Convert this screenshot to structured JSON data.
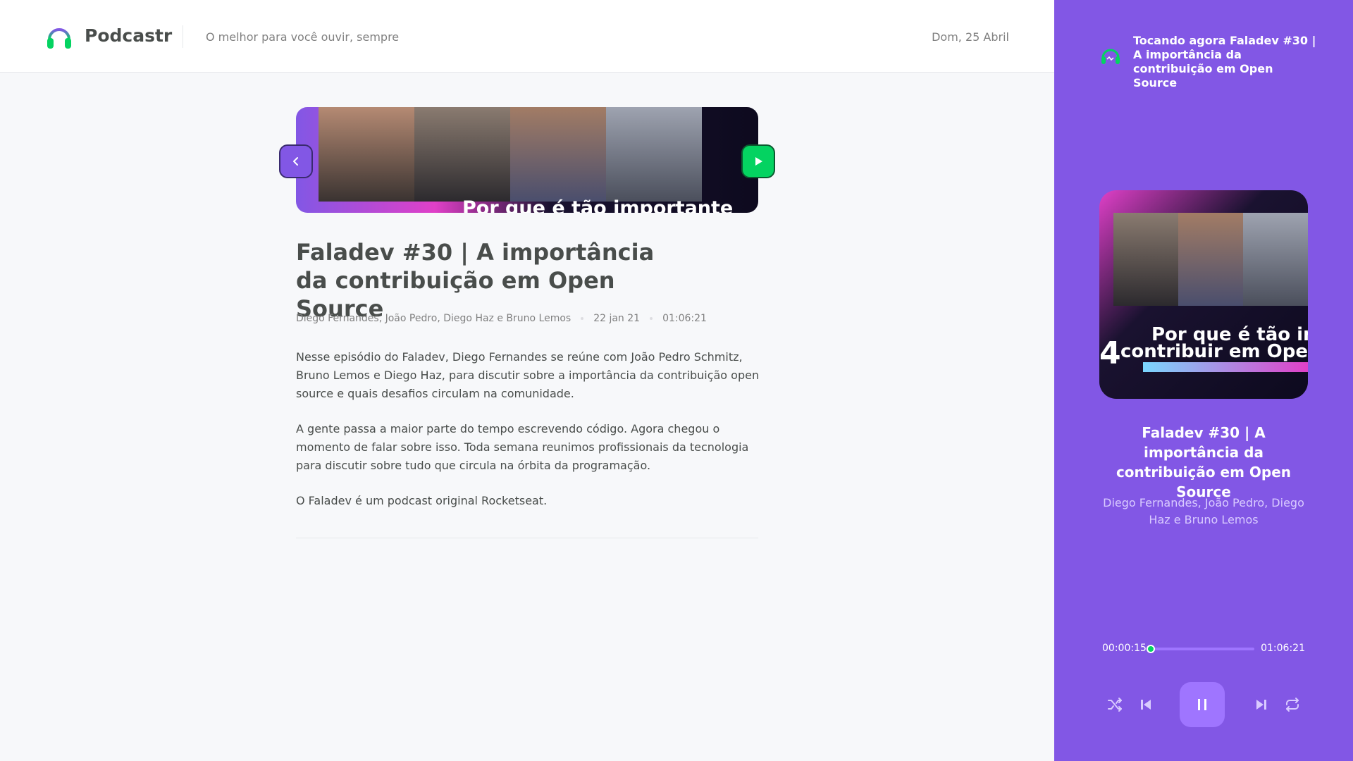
{
  "app": {
    "name": "Podcastr",
    "tagline": "O melhor para você ouvir, sempre",
    "date": "Dom, 25 Abril"
  },
  "episode": {
    "title": "Faladev #30 | A importância da contribuição em Open Source",
    "members": "Diego Fernandes, João Pedro, Diego Haz e Bruno Lemos",
    "published_at": "22 jan 21",
    "duration": "01:06:21",
    "thumbnail_caption": "Por que é tão importante",
    "description": [
      "Nesse episódio do Faladev, Diego Fernandes se reúne com João Pedro Schmitz, Bruno Lemos e Diego Haz, para discutir sobre a importância da contribuição open source e quais desafios circulam na comunidade.",
      "A gente passa a maior parte do tempo escrevendo código. Agora chegou o momento de falar sobre isso. Toda semana reunimos profissionais da tecnologia para discutir sobre tudo que circula na órbita da programação.",
      "O Faladev é um podcast original Rocketseat."
    ]
  },
  "player": {
    "now_playing": "Tocando agora Faladev #30 | A importância da contribuição em Open Source",
    "cover_caption_1": "Por que é tão imp",
    "cover_caption_2": "contribuir em Open S",
    "cover_number": "4",
    "title": "Faladev #30 | A importância da contribuição em Open Source",
    "members": "Diego Fernandes, João Pedro, Diego Haz e Bruno Lemos",
    "current_time": "00:00:15",
    "total_time": "01:06:21",
    "progress": 0.004,
    "state": "playing"
  },
  "icons": {
    "logo": "headphones-icon",
    "back": "chevron-left-icon",
    "play": "play-icon",
    "shuffle": "shuffle-icon",
    "previous": "skip-previous-icon",
    "pause": "pause-icon",
    "next": "skip-next-icon",
    "repeat": "repeat-icon"
  },
  "colors": {
    "brand": "#8257e5",
    "accent_green": "#04d361",
    "background": "#f7f8fa",
    "text_dark": "#494d4b",
    "text_muted": "#808080"
  }
}
